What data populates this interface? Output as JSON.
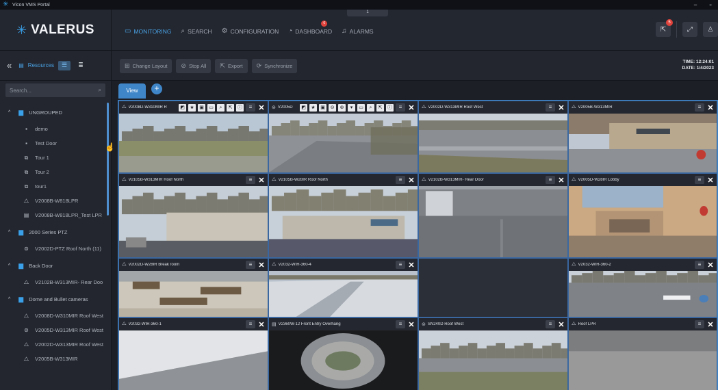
{
  "window": {
    "title": "Vicon VMS Portal",
    "minimize": "−",
    "restore": "▫"
  },
  "brand": {
    "name": "VALERUS"
  },
  "header_tab": "1",
  "nav": [
    {
      "label": "MONITORING",
      "icon": "monitor-icon",
      "glyph": "▭",
      "active": true
    },
    {
      "label": "SEARCH",
      "icon": "search-icon",
      "glyph": "⌕"
    },
    {
      "label": "CONFIGURATION",
      "icon": "configuration-icon",
      "glyph": "⚙"
    },
    {
      "label": "DASHBOARD",
      "icon": "dashboard-icon",
      "glyph": "◔",
      "badge": "6"
    },
    {
      "label": "ALARMS",
      "icon": "bell-icon",
      "glyph": "♫"
    }
  ],
  "header_actions": {
    "notifications_badge": "5"
  },
  "sidebar": {
    "resources_label": "Resources",
    "search_placeholder": "Search...",
    "items": [
      {
        "kind": "group",
        "label": "UNGROUPED"
      },
      {
        "kind": "item",
        "label": "demo",
        "icon": "document-icon",
        "glyph": "▪"
      },
      {
        "kind": "item",
        "label": "Test Door",
        "icon": "document-icon",
        "glyph": "▪"
      },
      {
        "kind": "item",
        "label": "Tour 1",
        "icon": "tour-icon",
        "glyph": "⧉"
      },
      {
        "kind": "item",
        "label": "Tour 2",
        "icon": "tour-icon",
        "glyph": "⧉"
      },
      {
        "kind": "item",
        "label": "tour1",
        "icon": "tour-icon",
        "glyph": "⧉"
      },
      {
        "kind": "item",
        "label": "V2008B-W818LPR",
        "icon": "camera-icon",
        "glyph": "⧍"
      },
      {
        "kind": "item",
        "label": "V2008B-W818LPR_Test LPR",
        "icon": "lpr-icon",
        "glyph": "▤"
      },
      {
        "kind": "group",
        "label": "2000 Series PTZ"
      },
      {
        "kind": "item",
        "label": "V2002D-PTZ Roof North (11)",
        "icon": "ptz-icon",
        "glyph": "⊜"
      },
      {
        "kind": "group",
        "label": "Back Door"
      },
      {
        "kind": "item",
        "label": "V2102B-W313MIR- Rear Doo",
        "icon": "camera-icon",
        "glyph": "⧍"
      },
      {
        "kind": "group",
        "label": "Dome and Bullet cameras"
      },
      {
        "kind": "item",
        "label": "V2008D-W310MIR Roof West",
        "icon": "camera-icon",
        "glyph": "⧍"
      },
      {
        "kind": "item",
        "label": "V2005D-W313MIR Roof West",
        "icon": "ptz-icon",
        "glyph": "⊜"
      },
      {
        "kind": "item",
        "label": "V2002D-W313MIR Roof West",
        "icon": "camera-icon",
        "glyph": "⧍"
      },
      {
        "kind": "item",
        "label": "V2005B-W313MIR",
        "icon": "camera-icon",
        "glyph": "⧍"
      }
    ]
  },
  "toolbar": {
    "change_layout": "Change Layout",
    "stop_all": "Stop All",
    "export": "Export",
    "synchronize": "Synchronize",
    "time_label": "TIME: 12:24:01",
    "date_label": "DATE: 1/4/2023"
  },
  "view_tab": "View",
  "cameras": [
    {
      "title": "V2008D-W310MIR R",
      "scene": "lawn",
      "icon": "⧍",
      "controls": true
    },
    {
      "title": "V2005D",
      "scene": "lot",
      "icon": "⊜",
      "controls": true
    },
    {
      "title": "V2002D-W313MIR Roof West",
      "scene": "lot2",
      "icon": "⧍"
    },
    {
      "title": "V2005B-W313MIR",
      "scene": "building",
      "icon": "⧍"
    },
    {
      "title": "V2105B-W313MIR Roof North",
      "scene": "building2",
      "icon": "⧍"
    },
    {
      "title": "V2105B-W28IR Roof North",
      "scene": "building3",
      "icon": "⧍"
    },
    {
      "title": "V2102B-W313MIR- Rear Door",
      "scene": "rear",
      "icon": "⧍"
    },
    {
      "title": "V2005D-W28IR Lobby",
      "scene": "lobby",
      "icon": "⧍"
    },
    {
      "title": "V2002D-W28IR Break room",
      "scene": "breakroom",
      "icon": "⧍"
    },
    {
      "title": "V2032-WIR-360-4",
      "scene": "roof",
      "icon": "⧍"
    },
    {
      "title": "",
      "scene": "empty"
    },
    {
      "title": "V2032-WIR-360-2",
      "scene": "lot3",
      "icon": "⧍"
    },
    {
      "title": "V2032-WIR-360-1",
      "scene": "corner",
      "icon": "⧍"
    },
    {
      "title": "V2360W-12 Front Entry Overhang",
      "scene": "fisheye",
      "icon": "▤"
    },
    {
      "title": "SN240D Roof West",
      "scene": "roofwest",
      "icon": "⊜"
    },
    {
      "title": "Roof LPR",
      "scene": "lpr",
      "icon": "⧍"
    }
  ],
  "tile_control_glyphs": [
    "◩",
    "★",
    "▣",
    "▭",
    "⌕",
    "⇱",
    "ⓘ"
  ],
  "tile_control_glyphs_ptz": [
    "◩",
    "★",
    "▣",
    "⊖",
    "⊕",
    "▾",
    "▭",
    "⌕",
    "⇱",
    "ⓘ"
  ],
  "tile_menu_glyph": "≡",
  "tile_close_glyph": "✕"
}
